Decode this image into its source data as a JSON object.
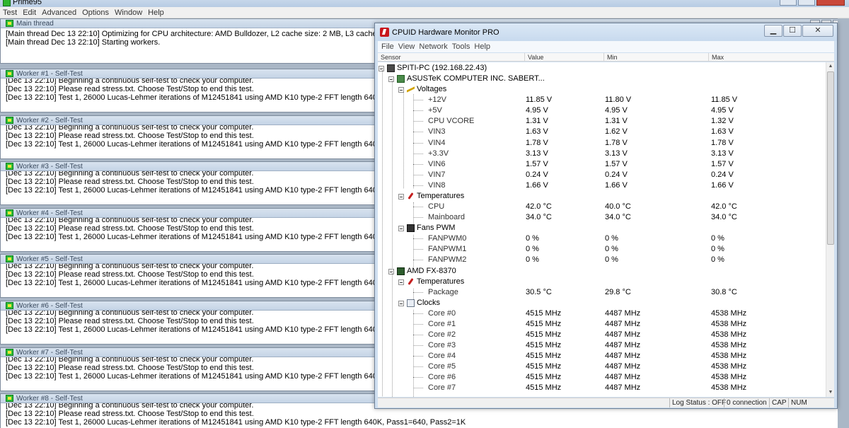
{
  "prime95": {
    "title": "Prime95",
    "menu": [
      "Test",
      "Edit",
      "Advanced",
      "Options",
      "Window",
      "Help"
    ],
    "main_thread": {
      "title": "Main thread",
      "lines": [
        "[Main thread Dec 13 22:10] Optimizing for CPU architecture: AMD Bulldozer, L2 cache size: 2 MB, L3 cache",
        "[Main thread Dec 13 22:10] Starting workers."
      ]
    },
    "workers": [
      {
        "title": "Worker #1 - Self-Test",
        "lines": [
          "[Dec 13 22:10] Beginning a continuous self-test to check your computer.",
          "[Dec 13 22:10] Please read stress.txt.  Choose Test/Stop to end this test.",
          "[Dec 13 22:10] Test 1, 26000 Lucas-Lehmer iterations of M12451841 using AMD K10 type-2 FFT length 640K,"
        ]
      },
      {
        "title": "Worker #2 - Self-Test",
        "lines": [
          "[Dec 13 22:10] Beginning a continuous self-test to check your computer.",
          "[Dec 13 22:10] Please read stress.txt.  Choose Test/Stop to end this test.",
          "[Dec 13 22:10] Test 1, 26000 Lucas-Lehmer iterations of M12451841 using AMD K10 type-2 FFT length 640K,"
        ]
      },
      {
        "title": "Worker #3 - Self-Test",
        "lines": [
          "[Dec 13 22:10] Beginning a continuous self-test to check your computer.",
          "[Dec 13 22:10] Please read stress.txt.  Choose Test/Stop to end this test.",
          "[Dec 13 22:10] Test 1, 26000 Lucas-Lehmer iterations of M12451841 using AMD K10 type-2 FFT length 640K,"
        ]
      },
      {
        "title": "Worker #4 - Self-Test",
        "lines": [
          "[Dec 13 22:10] Beginning a continuous self-test to check your computer.",
          "[Dec 13 22:10] Please read stress.txt.  Choose Test/Stop to end this test.",
          "[Dec 13 22:10] Test 1, 26000 Lucas-Lehmer iterations of M12451841 using AMD K10 type-2 FFT length 640K,"
        ]
      },
      {
        "title": "Worker #5 - Self-Test",
        "lines": [
          "[Dec 13 22:10] Beginning a continuous self-test to check your computer.",
          "[Dec 13 22:10] Please read stress.txt.  Choose Test/Stop to end this test.",
          "[Dec 13 22:10] Test 1, 26000 Lucas-Lehmer iterations of M12451841 using AMD K10 type-2 FFT length 640K,"
        ]
      },
      {
        "title": "Worker #6 - Self-Test",
        "lines": [
          "[Dec 13 22:10] Beginning a continuous self-test to check your computer.",
          "[Dec 13 22:10] Please read stress.txt.  Choose Test/Stop to end this test.",
          "[Dec 13 22:10] Test 1, 26000 Lucas-Lehmer iterations of M12451841 using AMD K10 type-2 FFT length 640K,"
        ]
      },
      {
        "title": "Worker #7 - Self-Test",
        "lines": [
          "[Dec 13 22:10] Beginning a continuous self-test to check your computer.",
          "[Dec 13 22:10] Please read stress.txt.  Choose Test/Stop to end this test.",
          "[Dec 13 22:10] Test 1, 26000 Lucas-Lehmer iterations of M12451841 using AMD K10 type-2 FFT length 640K,"
        ]
      },
      {
        "title": "Worker #8 - Self-Test",
        "lines": [
          "[Dec 13 22:10] Beginning a continuous self-test to check your computer.",
          "[Dec 13 22:10] Please read stress.txt.  Choose Test/Stop to end this test.",
          "[Dec 13 22:10] Test 1, 26000 Lucas-Lehmer iterations of M12451841 using AMD K10 type-2 FFT length 640K, Pass1=640, Pass2=1K"
        ]
      }
    ]
  },
  "cpuid": {
    "title": "CPUID Hardware Monitor PRO",
    "menu": [
      "File",
      "View",
      "Network",
      "Tools",
      "Help"
    ],
    "columns": [
      "Sensor",
      "Value",
      "Min",
      "Max"
    ],
    "rows": [
      {
        "level": 0,
        "type": "group",
        "icon": "computer-icon",
        "name": "SPITI-PC (192.168.22.43)"
      },
      {
        "level": 1,
        "type": "group",
        "icon": "motherboard-icon",
        "name": "ASUSTeK COMPUTER INC. SABERT..."
      },
      {
        "level": 2,
        "type": "group",
        "icon": "voltage-icon",
        "name": "Voltages"
      },
      {
        "level": 3,
        "type": "leaf",
        "name": "+12V",
        "value": "11.85 V",
        "min": "11.80 V",
        "max": "11.85 V"
      },
      {
        "level": 3,
        "type": "leaf",
        "name": "+5V",
        "value": "4.95 V",
        "min": "4.95 V",
        "max": "4.95 V"
      },
      {
        "level": 3,
        "type": "leaf",
        "name": "CPU VCORE",
        "value": "1.31 V",
        "min": "1.31 V",
        "max": "1.32 V"
      },
      {
        "level": 3,
        "type": "leaf",
        "name": "VIN3",
        "value": "1.63 V",
        "min": "1.62 V",
        "max": "1.63 V"
      },
      {
        "level": 3,
        "type": "leaf",
        "name": "VIN4",
        "value": "1.78 V",
        "min": "1.78 V",
        "max": "1.78 V"
      },
      {
        "level": 3,
        "type": "leaf",
        "name": "+3.3V",
        "value": "3.13 V",
        "min": "3.13 V",
        "max": "3.13 V"
      },
      {
        "level": 3,
        "type": "leaf",
        "name": "VIN6",
        "value": "1.57 V",
        "min": "1.57 V",
        "max": "1.57 V"
      },
      {
        "level": 3,
        "type": "leaf",
        "name": "VIN7",
        "value": "0.24 V",
        "min": "0.24 V",
        "max": "0.24 V"
      },
      {
        "level": 3,
        "type": "leaf",
        "name": "VIN8",
        "value": "1.66 V",
        "min": "1.66 V",
        "max": "1.66 V"
      },
      {
        "level": 2,
        "type": "group",
        "icon": "thermometer-icon",
        "name": "Temperatures"
      },
      {
        "level": 3,
        "type": "leaf",
        "name": "CPU",
        "value": "42.0 °C",
        "min": "40.0 °C",
        "max": "42.0 °C"
      },
      {
        "level": 3,
        "type": "leaf",
        "name": "Mainboard",
        "value": "34.0 °C",
        "min": "34.0 °C",
        "max": "34.0 °C"
      },
      {
        "level": 2,
        "type": "group",
        "icon": "fan-icon",
        "name": "Fans PWM"
      },
      {
        "level": 3,
        "type": "leaf",
        "name": "FANPWM0",
        "value": "0 %",
        "min": "0 %",
        "max": "0 %"
      },
      {
        "level": 3,
        "type": "leaf",
        "name": "FANPWM1",
        "value": "0 %",
        "min": "0 %",
        "max": "0 %"
      },
      {
        "level": 3,
        "type": "leaf",
        "name": "FANPWM2",
        "value": "0 %",
        "min": "0 %",
        "max": "0 %"
      },
      {
        "level": 1,
        "type": "group",
        "icon": "cpu-icon",
        "name": "AMD FX-8370"
      },
      {
        "level": 2,
        "type": "group",
        "icon": "thermometer-icon",
        "name": "Temperatures"
      },
      {
        "level": 3,
        "type": "leaf",
        "name": "Package",
        "value": "30.5 °C",
        "min": "29.8 °C",
        "max": "30.8 °C"
      },
      {
        "level": 2,
        "type": "group",
        "icon": "clock-icon",
        "name": "Clocks"
      },
      {
        "level": 3,
        "type": "leaf",
        "name": "Core #0",
        "value": "4515 MHz",
        "min": "4487 MHz",
        "max": "4538 MHz"
      },
      {
        "level": 3,
        "type": "leaf",
        "name": "Core #1",
        "value": "4515 MHz",
        "min": "4487 MHz",
        "max": "4538 MHz"
      },
      {
        "level": 3,
        "type": "leaf",
        "name": "Core #2",
        "value": "4515 MHz",
        "min": "4487 MHz",
        "max": "4538 MHz"
      },
      {
        "level": 3,
        "type": "leaf",
        "name": "Core #3",
        "value": "4515 MHz",
        "min": "4487 MHz",
        "max": "4538 MHz"
      },
      {
        "level": 3,
        "type": "leaf",
        "name": "Core #4",
        "value": "4515 MHz",
        "min": "4487 MHz",
        "max": "4538 MHz"
      },
      {
        "level": 3,
        "type": "leaf",
        "name": "Core #5",
        "value": "4515 MHz",
        "min": "4487 MHz",
        "max": "4538 MHz"
      },
      {
        "level": 3,
        "type": "leaf",
        "name": "Core #6",
        "value": "4515 MHz",
        "min": "4487 MHz",
        "max": "4538 MHz"
      },
      {
        "level": 3,
        "type": "leaf",
        "name": "Core #7",
        "value": "4515 MHz",
        "min": "4487 MHz",
        "max": "4538 MHz"
      }
    ],
    "status": {
      "log": "Log Status : OFF",
      "connection": "0 connection",
      "cap": "CAP",
      "num": "NUM"
    }
  }
}
